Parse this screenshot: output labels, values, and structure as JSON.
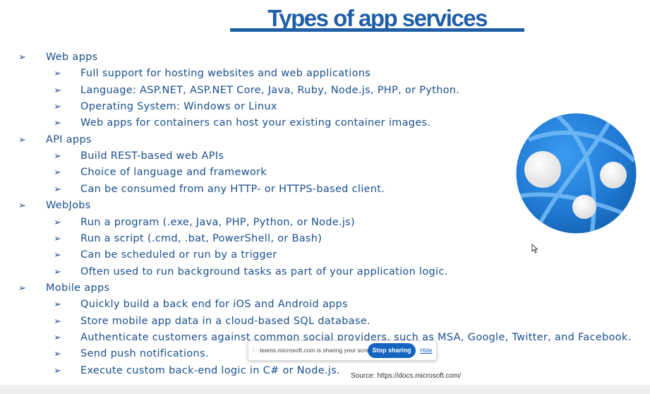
{
  "slide": {
    "title": "Types of app services",
    "source": "Source: https://docs.microsoft.com/",
    "bullet_glyph": "➢",
    "sections": [
      {
        "heading": "Web apps",
        "items": [
          "Full support for hosting websites and web applications",
          "Language: ASP.NET, ASP.NET Core, Java, Ruby, Node.js, PHP, or Python.",
          "Operating System: Windows or Linux",
          "Web apps for containers can host your existing container images."
        ]
      },
      {
        "heading": "API apps",
        "items": [
          "Build REST-based web APIs",
          "Choice of language and framework",
          "Can be consumed from any HTTP- or HTTPS-based client."
        ]
      },
      {
        "heading": "WebJobs",
        "items": [
          "Run a program (.exe, Java, PHP, Python, or Node.js)",
          "Run a script (.cmd, .bat, PowerShell, or Bash)",
          "Can be scheduled or run by a trigger",
          "Often used to run background tasks as part of your application logic."
        ]
      },
      {
        "heading": "Mobile apps",
        "items": [
          "Quickly build a back end for iOS and Android apps",
          "Store mobile app data in a cloud-based SQL database.",
          "Authenticate customers against common social providers, such as MSA, Google, Twitter, and Facebook.",
          "Send push notifications.",
          "Execute custom back-end logic in C# or Node.js."
        ]
      }
    ]
  },
  "share_toast": {
    "message": "teams.microsoft.com is sharing your screen.",
    "stop_label": "Stop sharing",
    "hide_label": "Hide"
  },
  "icons": {
    "logo": "azure-app-service-icon",
    "cursor": "mouse-cursor-icon",
    "grip": "drag-grip-icon"
  },
  "colors": {
    "title": "#1f5fa8",
    "text": "#1b4f8c",
    "logo_blue": "#1f78d1",
    "stop_button": "#1565c0"
  }
}
